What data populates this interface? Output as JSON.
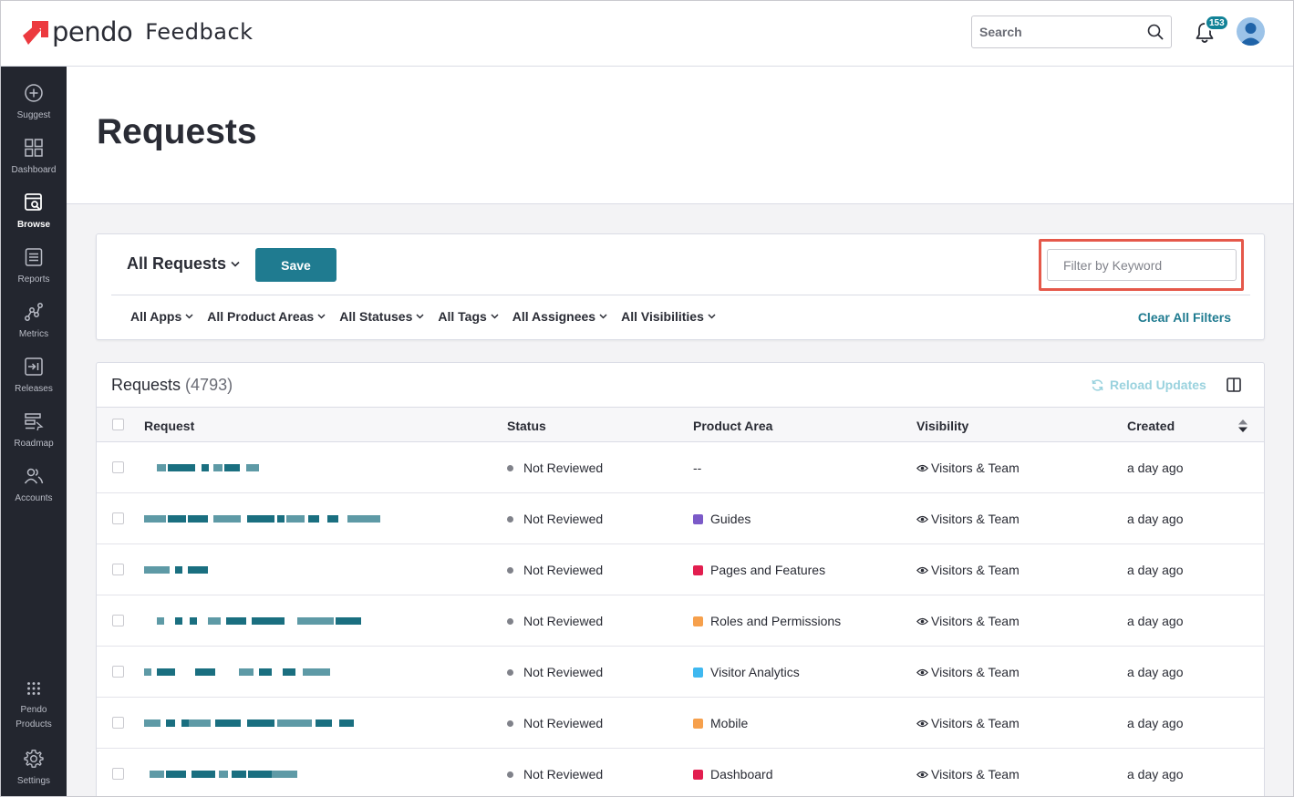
{
  "app": {
    "logo_text": "pendo",
    "product": "Feedback",
    "brand_color": "#ec3a3f",
    "accent": "#1f7b90"
  },
  "topbar": {
    "search_placeholder": "Search",
    "notification_count": "153"
  },
  "sidebar": {
    "items": [
      {
        "label": "Suggest",
        "icon": "plus-circle-icon"
      },
      {
        "label": "Dashboard",
        "icon": "grid-icon"
      },
      {
        "label": "Browse",
        "icon": "browse-icon",
        "active": true
      },
      {
        "label": "Reports",
        "icon": "document-icon"
      },
      {
        "label": "Metrics",
        "icon": "metrics-icon"
      },
      {
        "label": "Releases",
        "icon": "releases-icon"
      },
      {
        "label": "Roadmap",
        "icon": "roadmap-icon"
      },
      {
        "label": "Accounts",
        "icon": "users-icon"
      }
    ],
    "bottom": [
      {
        "label_line1": "Pendo",
        "label_line2": "Products",
        "icon": "dots-grid-icon"
      },
      {
        "label": "Settings",
        "icon": "gear-icon"
      }
    ]
  },
  "page": {
    "title": "Requests"
  },
  "filters": {
    "view_label": "All Requests",
    "save_label": "Save",
    "keyword_placeholder": "Filter by Keyword",
    "items": [
      "All Apps",
      "All Product Areas",
      "All Statuses",
      "All Tags",
      "All Assignees",
      "All Visibilities"
    ],
    "clear_label": "Clear All Filters"
  },
  "table": {
    "title": "Requests",
    "count": "(4793)",
    "reload_label": "Reload Updates",
    "columns": [
      "Request",
      "Status",
      "Product Area",
      "Visibility",
      "Created"
    ],
    "rows": [
      {
        "status": "Not Reviewed",
        "area": "--",
        "area_color": "",
        "visibility": "Visitors & Team",
        "created": "a day ago"
      },
      {
        "status": "Not Reviewed",
        "area": "Guides",
        "area_color": "#7b5ac8",
        "visibility": "Visitors & Team",
        "created": "a day ago"
      },
      {
        "status": "Not Reviewed",
        "area": "Pages and Features",
        "area_color": "#e21e4f",
        "visibility": "Visitors & Team",
        "created": "a day ago"
      },
      {
        "status": "Not Reviewed",
        "area": "Roles and Permissions",
        "area_color": "#f6a04c",
        "visibility": "Visitors & Team",
        "created": "a day ago"
      },
      {
        "status": "Not Reviewed",
        "area": "Visitor Analytics",
        "area_color": "#3fb8f0",
        "visibility": "Visitors & Team",
        "created": "a day ago"
      },
      {
        "status": "Not Reviewed",
        "area": "Mobile",
        "area_color": "#f6a04c",
        "visibility": "Visitors & Team",
        "created": "a day ago"
      },
      {
        "status": "Not Reviewed",
        "area": "Dashboard",
        "area_color": "#e21e4f",
        "visibility": "Visitors & Team",
        "created": "a day ago"
      }
    ]
  }
}
